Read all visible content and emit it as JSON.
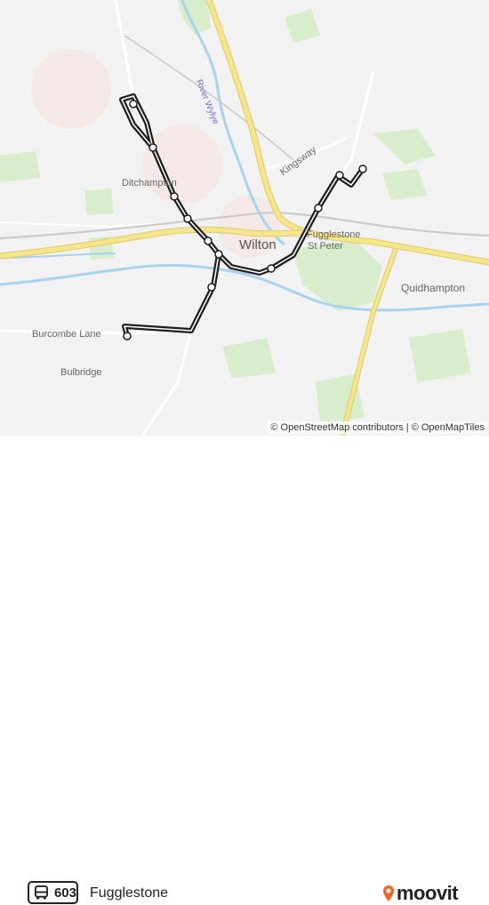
{
  "map": {
    "labels": {
      "river": "River Wylye",
      "kingsway": "Kingsway",
      "ditchampton": "Ditchampton",
      "wilton": "Wilton",
      "fugglestone_st_peter_line1": "Fugglestone",
      "fugglestone_st_peter_line2": "St Peter",
      "quidhampton": "Quidhampton",
      "burcombe_lane": "Burcombe Lane",
      "bulbridge": "Bulbridge"
    },
    "attribution": "© OpenStreetMap contributors | © OpenMapTiles",
    "colors": {
      "background": "#f2f2f2",
      "park": "#d7edcc",
      "water": "#a7d3f0",
      "major_road": "#f5e68a",
      "route_line": "#1f1f1f",
      "stop_fill": "#ffffff"
    }
  },
  "footer": {
    "route_number": "603",
    "destination": "Fugglestone",
    "brand": "moovit",
    "bus_icon": "bus-icon",
    "brand_icon": "moovit-pin-icon"
  }
}
